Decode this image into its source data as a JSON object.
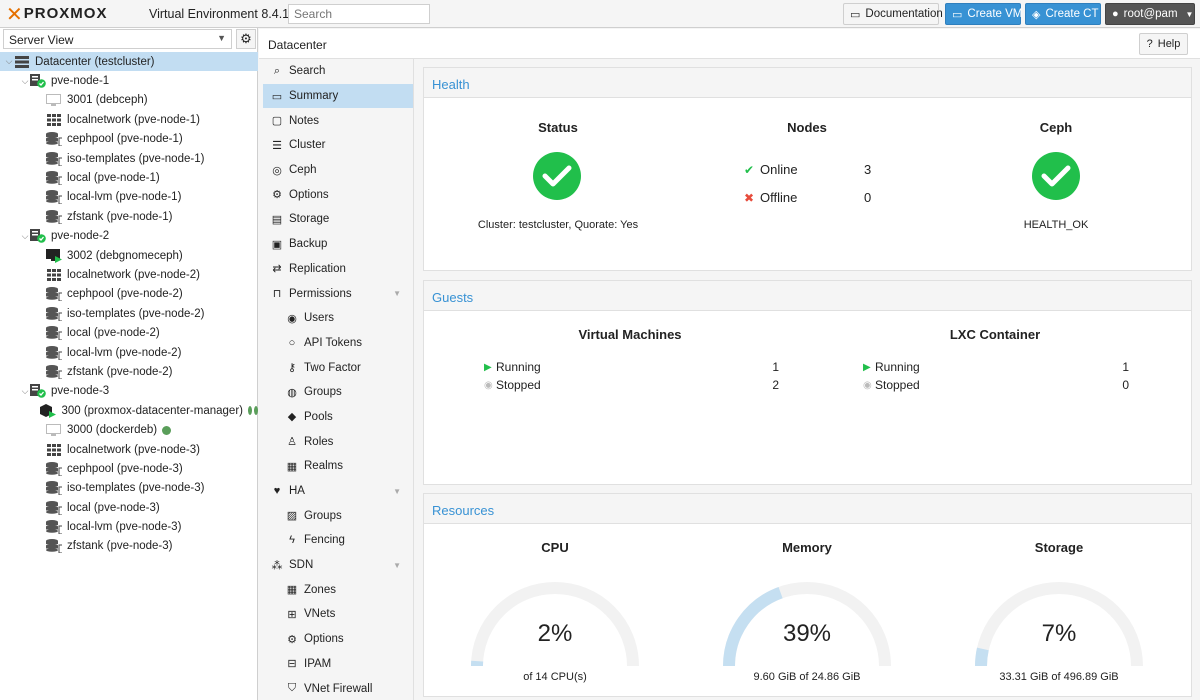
{
  "topbar": {
    "logo_text": "PROXMOX",
    "version": "Virtual Environment 8.4.1",
    "search_placeholder": "Search",
    "doc_label": "Documentation",
    "create_vm_label": "Create VM",
    "create_ct_label": "Create CT",
    "user_label": "root@pam"
  },
  "sidebar": {
    "view": "Server View",
    "tree": [
      {
        "label": "Datacenter (testcluster)",
        "icon": "datacenter-icon",
        "level": 0,
        "exp": "v",
        "selected": true
      },
      {
        "label": "pve-node-1",
        "icon": "node-online-icon",
        "level": 1,
        "exp": "v"
      },
      {
        "label": "3001 (debceph)",
        "icon": "vm-stopped-icon",
        "level": 2
      },
      {
        "label": "localnetwork (pve-node-1)",
        "icon": "network-grid-icon",
        "level": 2
      },
      {
        "label": "cephpool (pve-node-1)",
        "icon": "storage-icon",
        "level": 2
      },
      {
        "label": "iso-templates (pve-node-1)",
        "icon": "storage-icon",
        "level": 2
      },
      {
        "label": "local (pve-node-1)",
        "icon": "storage-icon",
        "level": 2
      },
      {
        "label": "local-lvm (pve-node-1)",
        "icon": "storage-icon",
        "level": 2
      },
      {
        "label": "zfstank (pve-node-1)",
        "icon": "storage-icon",
        "level": 2
      },
      {
        "label": "pve-node-2",
        "icon": "node-online-icon",
        "level": 1,
        "exp": "v"
      },
      {
        "label": "3002 (debgnomeceph)",
        "icon": "vm-running-icon",
        "level": 2
      },
      {
        "label": "localnetwork (pve-node-2)",
        "icon": "network-grid-icon",
        "level": 2
      },
      {
        "label": "cephpool (pve-node-2)",
        "icon": "storage-icon",
        "level": 2
      },
      {
        "label": "iso-templates (pve-node-2)",
        "icon": "storage-icon",
        "level": 2
      },
      {
        "label": "local (pve-node-2)",
        "icon": "storage-icon",
        "level": 2
      },
      {
        "label": "local-lvm (pve-node-2)",
        "icon": "storage-icon",
        "level": 2
      },
      {
        "label": "zfstank (pve-node-2)",
        "icon": "storage-icon",
        "level": 2
      },
      {
        "label": "pve-node-3",
        "icon": "node-online-icon",
        "level": 1,
        "exp": "v"
      },
      {
        "label": "300 (proxmox-datacenter-manager)",
        "icon": "container-running-icon",
        "level": 2,
        "dots": 2
      },
      {
        "label": "3000 (dockerdeb)",
        "icon": "vm-stopped-icon",
        "level": 2,
        "dots": 1
      },
      {
        "label": "localnetwork (pve-node-3)",
        "icon": "network-grid-icon",
        "level": 2
      },
      {
        "label": "cephpool (pve-node-3)",
        "icon": "storage-icon",
        "level": 2
      },
      {
        "label": "iso-templates (pve-node-3)",
        "icon": "storage-icon",
        "level": 2
      },
      {
        "label": "local (pve-node-3)",
        "icon": "storage-icon",
        "level": 2
      },
      {
        "label": "local-lvm (pve-node-3)",
        "icon": "storage-icon",
        "level": 2
      },
      {
        "label": "zfstank (pve-node-3)",
        "icon": "storage-icon",
        "level": 2
      }
    ]
  },
  "header": {
    "title": "Datacenter",
    "help_label": "Help"
  },
  "menu": [
    {
      "label": "Search",
      "icon": "search-icon",
      "glyph": "⌕"
    },
    {
      "label": "Summary",
      "icon": "book-icon",
      "glyph": "▭",
      "selected": true
    },
    {
      "label": "Notes",
      "icon": "notes-icon",
      "glyph": "▢"
    },
    {
      "label": "Cluster",
      "icon": "cluster-icon",
      "glyph": "☰"
    },
    {
      "label": "Ceph",
      "icon": "ceph-icon",
      "glyph": "◎"
    },
    {
      "label": "Options",
      "icon": "gear-icon",
      "glyph": "⚙"
    },
    {
      "label": "Storage",
      "icon": "storage-icon",
      "glyph": "▤"
    },
    {
      "label": "Backup",
      "icon": "floppy-icon",
      "glyph": "▣"
    },
    {
      "label": "Replication",
      "icon": "retweet-icon",
      "glyph": "⇄"
    },
    {
      "label": "Permissions",
      "icon": "unlock-icon",
      "glyph": "⊓",
      "collapse": true
    },
    {
      "label": "Users",
      "icon": "user-icon",
      "glyph": "◉",
      "sub": true
    },
    {
      "label": "API Tokens",
      "icon": "user-outline-icon",
      "glyph": "○",
      "sub": true
    },
    {
      "label": "Two Factor",
      "icon": "key-icon",
      "glyph": "⚷",
      "sub": true
    },
    {
      "label": "Groups",
      "icon": "users-icon",
      "glyph": "◍",
      "sub": true
    },
    {
      "label": "Pools",
      "icon": "tags-icon",
      "glyph": "◆",
      "sub": true
    },
    {
      "label": "Roles",
      "icon": "male-icon",
      "glyph": "♙",
      "sub": true
    },
    {
      "label": "Realms",
      "icon": "address-book-icon",
      "glyph": "▦",
      "sub": true
    },
    {
      "label": "HA",
      "icon": "heartbeat-icon",
      "glyph": "♥",
      "collapse": true
    },
    {
      "label": "Groups",
      "icon": "object-group-icon",
      "glyph": "▨",
      "sub": true
    },
    {
      "label": "Fencing",
      "icon": "bolt-icon",
      "glyph": "ϟ",
      "sub": true
    },
    {
      "label": "SDN",
      "icon": "sdn-icon",
      "glyph": "⁂",
      "collapse": true
    },
    {
      "label": "Zones",
      "icon": "grid-icon",
      "glyph": "▦",
      "sub": true
    },
    {
      "label": "VNets",
      "icon": "network-icon",
      "glyph": "⊞",
      "sub": true
    },
    {
      "label": "Options",
      "icon": "gear-icon",
      "glyph": "⚙",
      "sub": true
    },
    {
      "label": "IPAM",
      "icon": "ipam-icon",
      "glyph": "⊟",
      "sub": true
    },
    {
      "label": "VNet Firewall",
      "icon": "shield-icon",
      "glyph": "⛉",
      "sub": true
    }
  ],
  "health": {
    "title": "Health",
    "status": {
      "title": "Status",
      "text": "Cluster: testcluster, Quorate: Yes"
    },
    "nodes": {
      "title": "Nodes",
      "online_label": "Online",
      "online_count": "3",
      "offline_label": "Offline",
      "offline_count": "0"
    },
    "ceph": {
      "title": "Ceph",
      "text": "HEALTH_OK"
    }
  },
  "guests": {
    "title": "Guests",
    "vms": {
      "title": "Virtual Machines",
      "running_label": "Running",
      "running": "1",
      "stopped_label": "Stopped",
      "stopped": "2"
    },
    "lxc": {
      "title": "LXC Container",
      "running_label": "Running",
      "running": "1",
      "stopped_label": "Stopped",
      "stopped": "0"
    }
  },
  "resources": {
    "title": "Resources",
    "cpu": {
      "title": "CPU",
      "value": "2%",
      "fraction": 0.02,
      "text": "of 14 CPU(s)"
    },
    "memory": {
      "title": "Memory",
      "value": "39%",
      "fraction": 0.39,
      "text": "9.60 GiB of 24.86 GiB"
    },
    "storage": {
      "title": "Storage",
      "value": "7%",
      "fraction": 0.07,
      "text": "33.31 GiB of 496.89 GiB"
    }
  },
  "colors": {
    "accent": "#3892d4",
    "ok": "#21bf4b",
    "gauge_fill": "#c5dff1",
    "gauge_bg": "#f2f2f2",
    "selected": "#c2ddf2"
  }
}
